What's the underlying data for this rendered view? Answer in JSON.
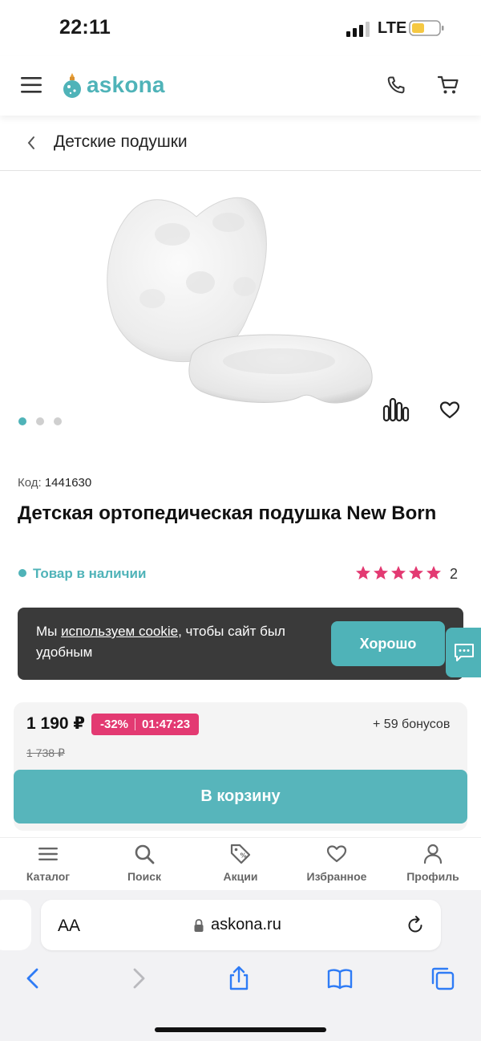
{
  "status": {
    "time": "22:11",
    "network": "LTE"
  },
  "header": {
    "logo_text": "askona"
  },
  "breadcrumb": {
    "label": "Детские подушки"
  },
  "gallery": {
    "dots": 3,
    "active_index": 0
  },
  "product": {
    "code_label": "Код:",
    "code_value": "1441630",
    "title": "Детская ортопедическая подушка New Born",
    "stock": "Товар в наличии",
    "rating_stars": 5,
    "reviews_count": "2"
  },
  "cookie": {
    "text_before": "Мы ",
    "link": "используем cookie",
    "text_after": ", чтобы сайт был удобным",
    "button": "Хорошо"
  },
  "price": {
    "current": "1 190 ₽",
    "discount": "-32%",
    "timer": "01:47:23",
    "bonus": "+ 59 бонусов",
    "old": "1 738 ₽",
    "cart_button": "В корзину"
  },
  "bottom_nav": [
    {
      "label": "Каталог",
      "icon": "menu-icon"
    },
    {
      "label": "Поиск",
      "icon": "search-icon"
    },
    {
      "label": "Акции",
      "icon": "tag-icon"
    },
    {
      "label": "Избранное",
      "icon": "heart-icon"
    },
    {
      "label": "Профиль",
      "icon": "user-icon"
    }
  ],
  "browser": {
    "aa": "AA",
    "url": "askona.ru"
  },
  "colors": {
    "brand": "#4fb3b8",
    "promo": "#e33a72",
    "star": "#e33a72"
  }
}
